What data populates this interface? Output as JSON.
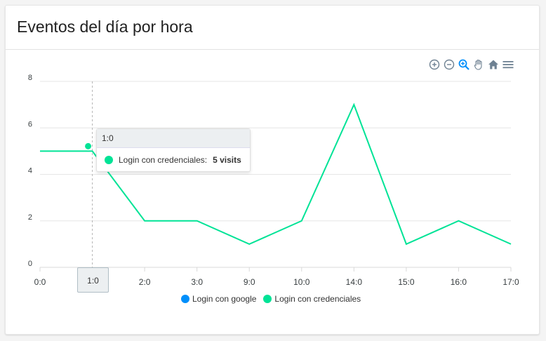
{
  "card": {
    "title": "Eventos del día por hora"
  },
  "toolbar": {
    "items": [
      {
        "name": "zoom-in-icon"
      },
      {
        "name": "zoom-out-icon"
      },
      {
        "name": "selection-zoom-icon"
      },
      {
        "name": "pan-hand-icon"
      },
      {
        "name": "reset-home-icon"
      },
      {
        "name": "menu-icon"
      }
    ]
  },
  "chart_data": {
    "type": "line",
    "title": "Eventos del día por hora",
    "categories": [
      "0:0",
      "1:0",
      "2:0",
      "3:0",
      "9:0",
      "10:0",
      "14:0",
      "15:0",
      "16:0",
      "17:0"
    ],
    "series": [
      {
        "name": "Login con google",
        "values": [],
        "color": "#008ffb"
      },
      {
        "name": "Login con credenciales",
        "values": [
          5,
          5,
          2,
          2,
          1,
          2,
          7,
          1,
          2,
          1
        ],
        "color": "#00e396"
      }
    ],
    "ylim": [
      0,
      8
    ],
    "yticks": [
      0,
      2,
      4,
      6,
      8
    ],
    "grid": true,
    "legend": "bottom-center"
  },
  "tooltip": {
    "header": "1:0",
    "series_label": "Login con credenciales:",
    "value": "5 visits"
  },
  "crosshair_label": "1:0"
}
